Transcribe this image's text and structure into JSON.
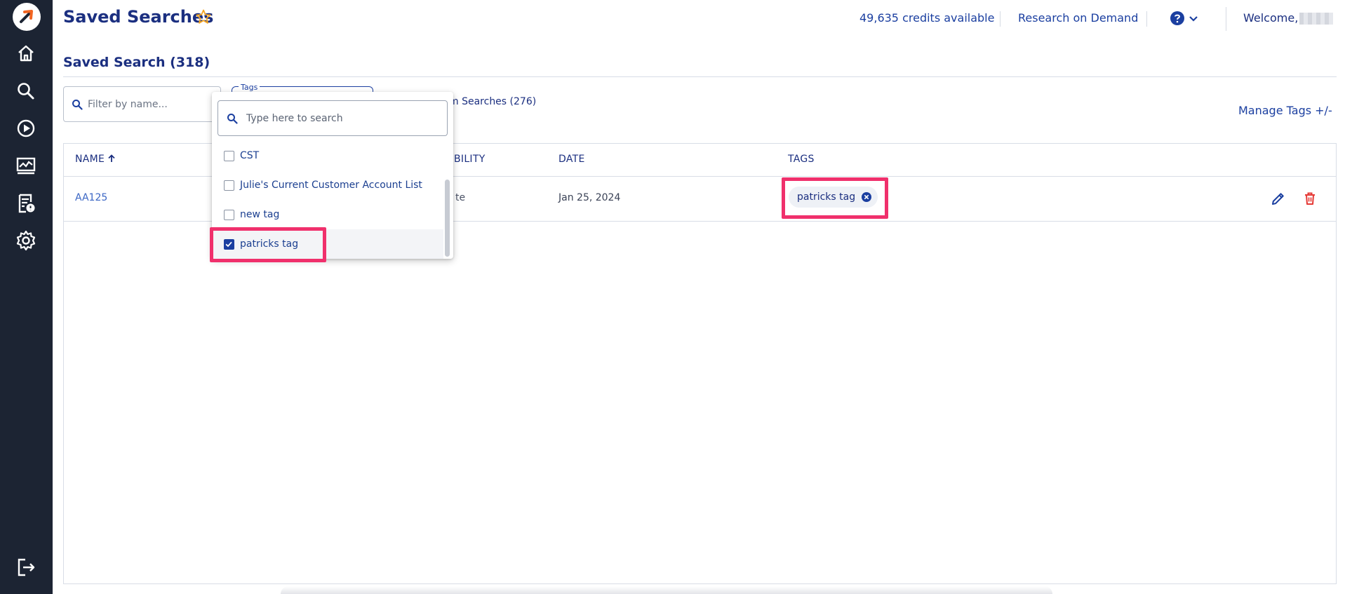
{
  "header": {
    "title": "Saved Searches",
    "credits": "49,635 credits available",
    "research_on_demand": "Research on Demand",
    "welcome": "Welcome,"
  },
  "section": {
    "title": "Saved Search (318)"
  },
  "filter": {
    "placeholder": "Filter by name..."
  },
  "tags_filter": {
    "label": "Tags"
  },
  "custom_searches": "m Searches (276)",
  "manage_tags": "Manage Tags +/-",
  "table": {
    "columns": {
      "name": "NAME",
      "visibility": "BILITY",
      "date": "DATE",
      "tags": "TAGS"
    },
    "rows": [
      {
        "name": "AA125",
        "visibility": "te",
        "date": "Jan 25, 2024",
        "tag": "patricks tag"
      }
    ]
  },
  "dropdown": {
    "search_placeholder": "Type here to search",
    "options": [
      {
        "label": "CST",
        "checked": false
      },
      {
        "label": "Julie's Current Customer Account List",
        "checked": false
      },
      {
        "label": "new tag",
        "checked": false
      },
      {
        "label": "patricks tag",
        "checked": true
      }
    ]
  },
  "colors": {
    "sidebar": "#1c2433",
    "primary": "#1b3fa0",
    "highlight": "#f0306c",
    "star": "#f5a623",
    "delete": "#e53935",
    "logo_accent": "#f26522"
  },
  "icons": {
    "sidebar": [
      "home-icon",
      "search-icon",
      "play-icon",
      "chart-icon",
      "report-icon",
      "settings-icon",
      "logout-icon"
    ],
    "header": [
      "star-icon",
      "help-icon",
      "chevron-down-icon"
    ],
    "row_actions": [
      "edit-icon",
      "delete-icon"
    ]
  }
}
